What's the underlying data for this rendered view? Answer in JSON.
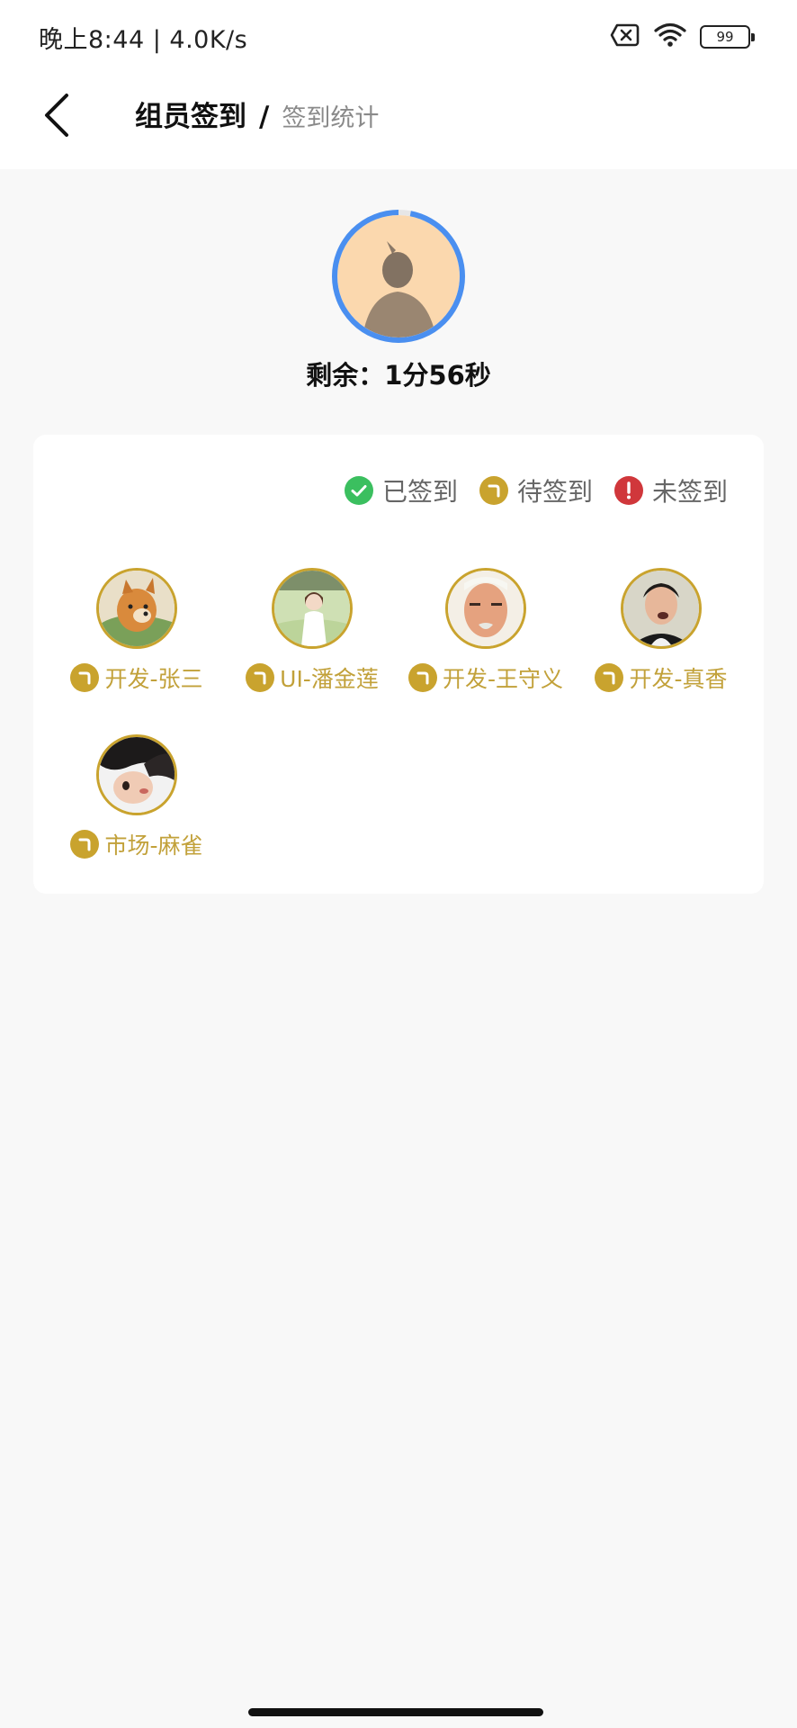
{
  "status_bar": {
    "time": "晚上8:44 | 4.0K/s",
    "battery": "99",
    "icons": [
      "sim-off-icon",
      "wifi-icon",
      "battery-icon"
    ]
  },
  "header": {
    "title": "组员签到",
    "separator": "/",
    "subtitle": "签到统计",
    "back_icon": "back-arrow-icon"
  },
  "timer": {
    "label": "剩余：1分56秒",
    "ring_color": "#4a8ff0",
    "progress_fraction": 0.97
  },
  "legend": [
    {
      "label": "已签到",
      "icon": "check-circle-icon",
      "color": "#3bbf5f"
    },
    {
      "label": "待签到",
      "icon": "pending-clock-icon",
      "color": "#c9a32e"
    },
    {
      "label": "未签到",
      "icon": "alert-circle-icon",
      "color": "#d0373b"
    }
  ],
  "members": [
    {
      "name": "开发-张三",
      "status": "pending",
      "avatar": "dog-avatar"
    },
    {
      "name": "UI-潘金莲",
      "status": "pending",
      "avatar": "girl-avatar"
    },
    {
      "name": "开发-王守义",
      "status": "pending",
      "avatar": "old-man-avatar"
    },
    {
      "name": "开发-真香",
      "status": "pending",
      "avatar": "man-avatar"
    },
    {
      "name": "市场-麻雀",
      "status": "pending",
      "avatar": "child-avatar"
    }
  ],
  "colors": {
    "pending": "#c9a32e",
    "background": "#f8f8f8"
  }
}
